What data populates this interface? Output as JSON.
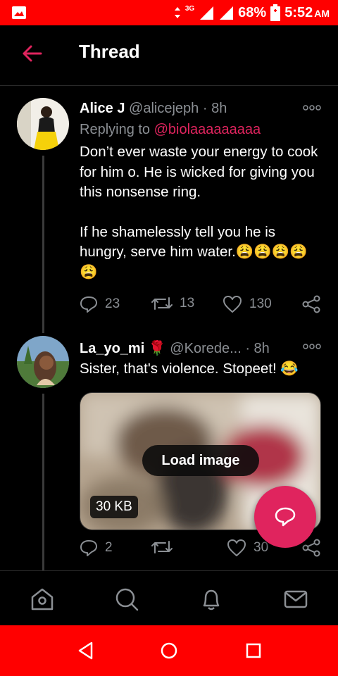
{
  "status_bar": {
    "network": "3G",
    "battery": "68%",
    "time": "5:52",
    "ampm": "AM",
    "color": "#ff0000"
  },
  "header": {
    "title": "Thread"
  },
  "tweets": [
    {
      "name": "Alice J",
      "handle": "@alicejeph",
      "time": "· 8h",
      "replying_prefix": "Replying to ",
      "replying_to": "@biolaaaaaaaaa",
      "paragraphs": [
        "Don’t ever waste your energy to cook for him o. He is wicked for giving you this nonsense ring.",
        "If he shamelessly tell you he is hungry, serve him water.😩😩😩😩😩"
      ],
      "replies": "23",
      "retweets": "13",
      "likes": "130"
    },
    {
      "name": "La_yo_mi",
      "name_emoji": "🌹",
      "handle": "@Korede...",
      "time": "· 8h",
      "text": "Sister, that's violence. Stopeet! 😂",
      "media_button": "Load image",
      "media_size": "30 KB",
      "replies": "2",
      "retweets": "",
      "likes": "30"
    }
  ],
  "colors": {
    "accent": "#e0245e",
    "muted": "#8b8f94"
  },
  "icons": {
    "back": "arrow-left-icon",
    "more": "more-dots-icon",
    "reply": "comment-icon",
    "retweet": "retweet-icon",
    "like": "heart-icon",
    "share": "share-icon",
    "compose": "compose-reply-icon",
    "nav": [
      "home-icon",
      "search-icon",
      "bell-icon",
      "mail-icon"
    ]
  }
}
